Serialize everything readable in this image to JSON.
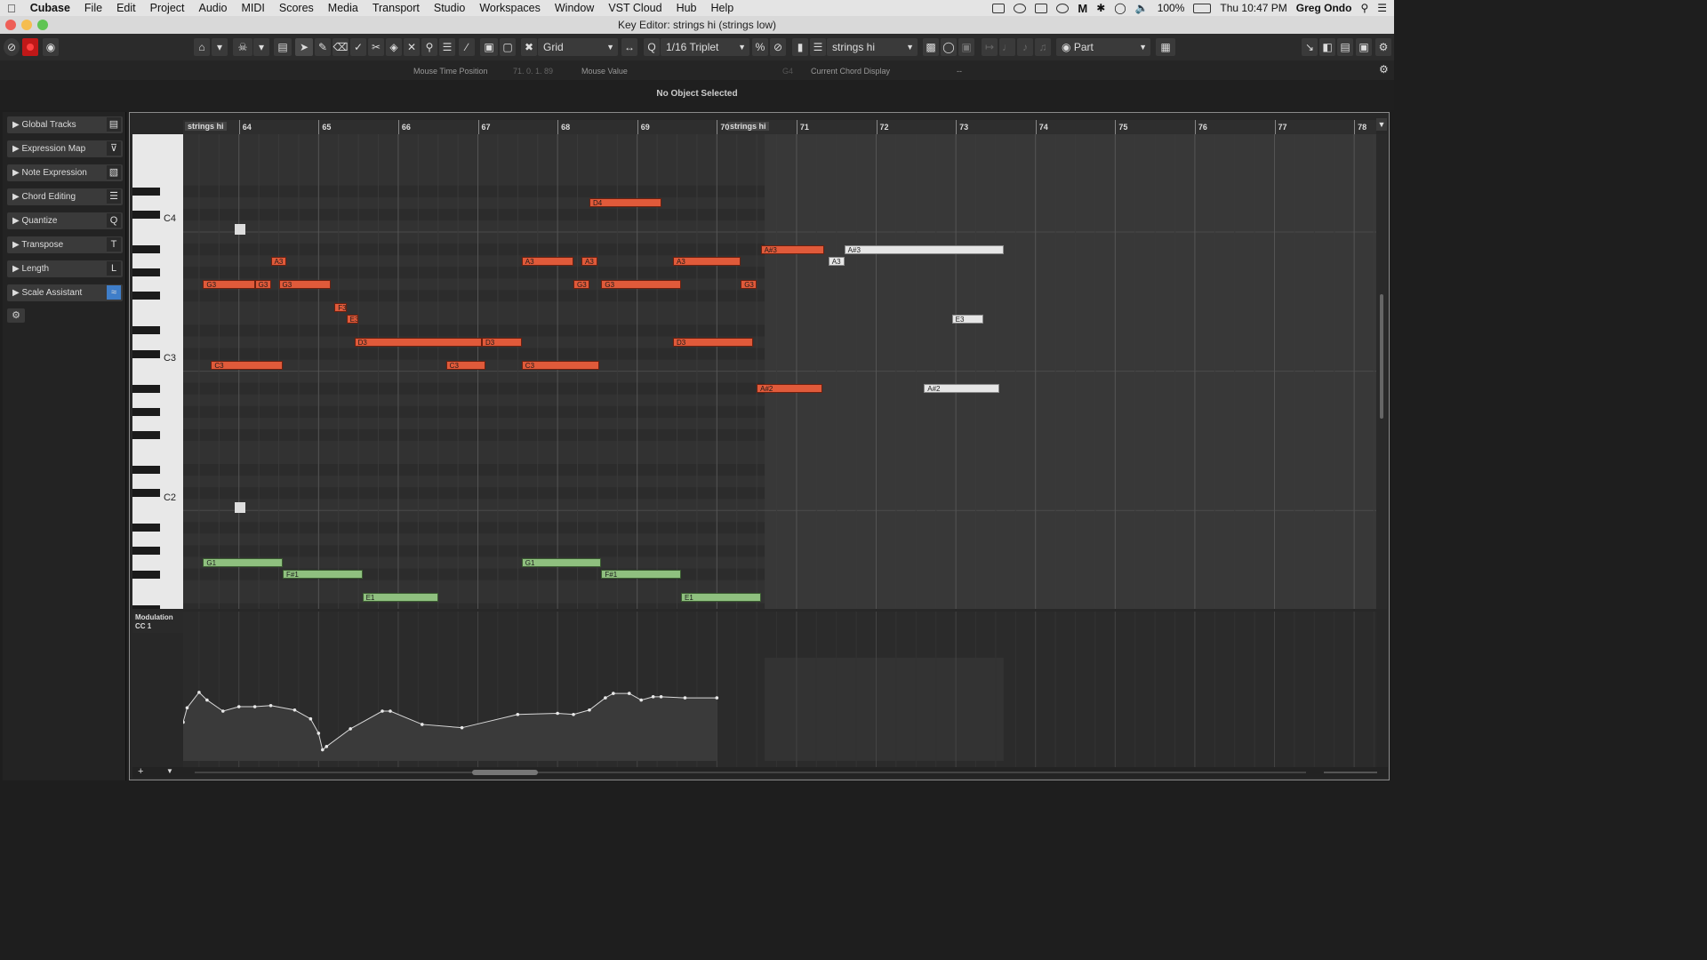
{
  "menubar": {
    "apple": "",
    "app": "Cubase",
    "items": [
      "File",
      "Edit",
      "Project",
      "Audio",
      "MIDI",
      "Scores",
      "Media",
      "Transport",
      "Studio",
      "Workspaces",
      "Window",
      "VST Cloud",
      "Hub",
      "Help"
    ],
    "battery": "100%",
    "clock": "Thu 10:47 PM",
    "user": "Greg Ondo"
  },
  "window": {
    "title": "Key Editor: strings hi (strings low)"
  },
  "toolbar": {
    "snap_label": "Grid",
    "quantize_label": "1/16 Triplet",
    "part_name": "strings hi",
    "edit_mode": "Part"
  },
  "infoline": {
    "mouse_time_label": "Mouse Time Position",
    "mouse_time_value": "71. 0. 1. 89",
    "mouse_value_label": "Mouse Value",
    "mouse_value": "G4",
    "chord_label": "Current Chord Display",
    "chord_value": "--",
    "status": "No Object Selected"
  },
  "inspector": {
    "sections": [
      {
        "label": "Global Tracks",
        "icon": "global-tracks-icon"
      },
      {
        "label": "Expression Map",
        "icon": "expression-map-icon"
      },
      {
        "label": "Note Expression",
        "icon": "note-expression-icon"
      },
      {
        "label": "Chord Editing",
        "icon": "chord-editing-icon"
      },
      {
        "label": "Quantize",
        "icon": "quantize-icon"
      },
      {
        "label": "Transpose",
        "icon": "transpose-icon"
      },
      {
        "label": "Length",
        "icon": "length-icon"
      },
      {
        "label": "Scale Assistant",
        "icon": "scale-assistant-icon"
      }
    ]
  },
  "ruler": {
    "bars": [
      "64",
      "65",
      "66",
      "67",
      "68",
      "69",
      "70",
      "71",
      "72",
      "73",
      "74",
      "75",
      "76",
      "77",
      "78"
    ],
    "part_labels": [
      "strings hi",
      "strings hi"
    ]
  },
  "keyboard": {
    "octave_labels": [
      "C4",
      "C3",
      "C2"
    ]
  },
  "notes": [
    {
      "pitch": "D4",
      "start": 68.4,
      "len": 0.9,
      "type": "hi"
    },
    {
      "pitch": "A#3",
      "start": 70.55,
      "len": 0.8,
      "type": "hi"
    },
    {
      "pitch": "A#3",
      "start": 71.6,
      "len": 2.0,
      "type": "sel"
    },
    {
      "pitch": "A3",
      "start": 64.4,
      "len": 0.2,
      "type": "hi"
    },
    {
      "pitch": "A3",
      "start": 67.55,
      "len": 0.65,
      "type": "hi"
    },
    {
      "pitch": "A3",
      "start": 68.3,
      "len": 0.2,
      "type": "hi"
    },
    {
      "pitch": "A3",
      "start": 69.45,
      "len": 0.85,
      "type": "hi"
    },
    {
      "pitch": "A3",
      "start": 71.4,
      "len": 0.2,
      "type": "sel"
    },
    {
      "pitch": "G3",
      "start": 63.55,
      "len": 0.65,
      "type": "hi"
    },
    {
      "pitch": "G3",
      "start": 64.2,
      "len": 0.2,
      "type": "hi"
    },
    {
      "pitch": "G3",
      "start": 64.5,
      "len": 0.65,
      "type": "hi"
    },
    {
      "pitch": "G3",
      "start": 68.2,
      "len": 0.2,
      "type": "hi"
    },
    {
      "pitch": "G3",
      "start": 68.55,
      "len": 1.0,
      "type": "hi"
    },
    {
      "pitch": "G3",
      "start": 70.3,
      "len": 0.2,
      "type": "hi"
    },
    {
      "pitch": "F3",
      "start": 65.2,
      "len": 0.15,
      "type": "hi"
    },
    {
      "pitch": "E3",
      "start": 65.35,
      "len": 0.15,
      "type": "hi"
    },
    {
      "pitch": "E3",
      "start": 72.95,
      "len": 0.4,
      "type": "sel"
    },
    {
      "pitch": "D3",
      "start": 65.45,
      "len": 1.6,
      "type": "hi"
    },
    {
      "pitch": "D3",
      "start": 67.05,
      "len": 0.5,
      "type": "hi"
    },
    {
      "pitch": "D3",
      "start": 69.45,
      "len": 1.0,
      "type": "hi"
    },
    {
      "pitch": "C3",
      "start": 63.65,
      "len": 0.9,
      "type": "hi"
    },
    {
      "pitch": "C3",
      "start": 66.6,
      "len": 0.5,
      "type": "hi"
    },
    {
      "pitch": "C3",
      "start": 67.55,
      "len": 0.97,
      "type": "hi"
    },
    {
      "pitch": "A#2",
      "start": 70.5,
      "len": 0.83,
      "type": "hi"
    },
    {
      "pitch": "A#2",
      "start": 72.6,
      "len": 0.95,
      "type": "sel"
    },
    {
      "pitch": "G1",
      "start": 63.55,
      "len": 1.0,
      "type": "lo"
    },
    {
      "pitch": "G1",
      "start": 67.55,
      "len": 1.0,
      "type": "lo"
    },
    {
      "pitch": "F#1",
      "start": 64.55,
      "len": 1.0,
      "type": "lo"
    },
    {
      "pitch": "F#1",
      "start": 68.55,
      "len": 1.0,
      "type": "lo"
    },
    {
      "pitch": "E1",
      "start": 65.55,
      "len": 0.95,
      "type": "lo"
    },
    {
      "pitch": "E1",
      "start": 69.55,
      "len": 1.0,
      "type": "lo"
    }
  ],
  "cc_lane": {
    "name": "Modulation",
    "cc": "CC 1",
    "points": [
      [
        63.0,
        27
      ],
      [
        63.1,
        31
      ],
      [
        63.2,
        31
      ],
      [
        63.3,
        35
      ],
      [
        63.35,
        48
      ],
      [
        63.5,
        62
      ],
      [
        63.6,
        55
      ],
      [
        63.8,
        45
      ],
      [
        64.0,
        49
      ],
      [
        64.2,
        49
      ],
      [
        64.4,
        50
      ],
      [
        64.7,
        46
      ],
      [
        64.9,
        38
      ],
      [
        65.0,
        25
      ],
      [
        65.05,
        10
      ],
      [
        65.1,
        13
      ],
      [
        65.4,
        29
      ],
      [
        65.8,
        45
      ],
      [
        65.9,
        45
      ],
      [
        66.3,
        33
      ],
      [
        66.8,
        30
      ],
      [
        67.5,
        42
      ],
      [
        68.0,
        43
      ],
      [
        68.2,
        42
      ],
      [
        68.4,
        46
      ],
      [
        68.6,
        57
      ],
      [
        68.7,
        61
      ],
      [
        68.9,
        61
      ],
      [
        69.05,
        55
      ],
      [
        69.2,
        58
      ],
      [
        69.3,
        58
      ],
      [
        69.6,
        57
      ],
      [
        70.0,
        57
      ]
    ],
    "max": 127
  },
  "colors": {
    "accent": "#e05a3a",
    "low": "#8fc07f",
    "selected": "#e6e6e6",
    "record": "#e02020"
  }
}
